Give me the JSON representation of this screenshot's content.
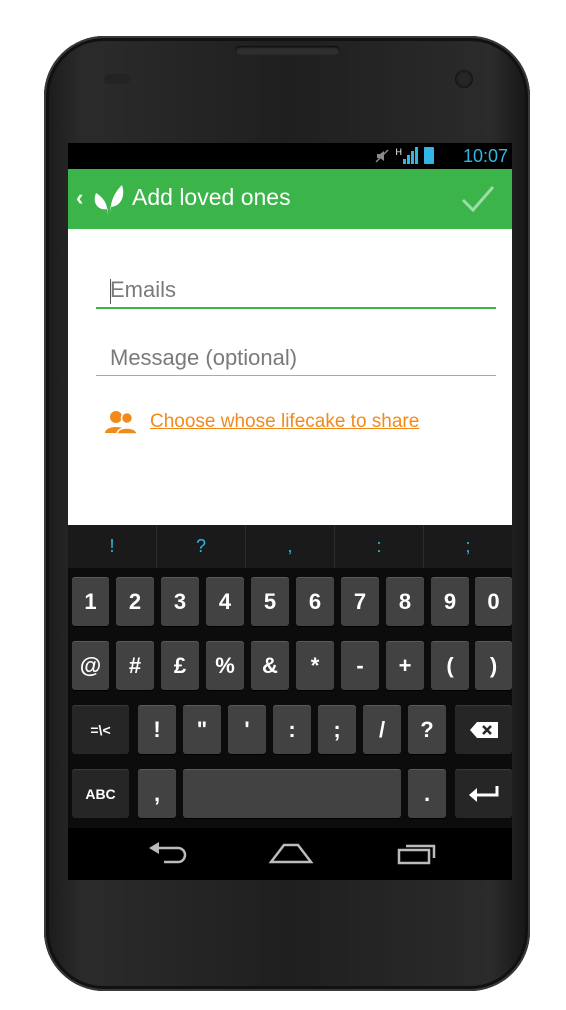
{
  "status_bar": {
    "time": "10:07",
    "network": "H",
    "icons": [
      "mute-icon",
      "signal-icon",
      "battery-icon"
    ],
    "accent_color": "#33b5e5"
  },
  "action_bar": {
    "title": "Add loved ones",
    "back_icon": "chevron-left-icon",
    "logo_icon": "leaf-logo-icon",
    "confirm_icon": "checkmark-icon",
    "bg_color": "#3bb44a"
  },
  "form": {
    "email_placeholder": "Emails",
    "message_placeholder": "Message (optional)",
    "share_link": "Choose whose lifecake to share",
    "share_icon": "people-icon",
    "link_color": "#f28a1a"
  },
  "keyboard": {
    "suggestions": [
      "!",
      "?",
      ",",
      ":",
      ";"
    ],
    "row1": [
      "1",
      "2",
      "3",
      "4",
      "5",
      "6",
      "7",
      "8",
      "9",
      "0"
    ],
    "row2": [
      "@",
      "#",
      "£",
      "%",
      "&",
      "*",
      "-",
      "+",
      "(",
      ")"
    ],
    "row3": [
      "=\\<",
      "!",
      "\"",
      "'",
      ":",
      ";",
      "/",
      "?"
    ],
    "row4": {
      "abc": "ABC",
      "comma": ",",
      "period": "."
    },
    "backspace_icon": "backspace-icon",
    "enter_icon": "enter-icon"
  },
  "nav_bar": {
    "icons": [
      "back-icon",
      "home-icon",
      "recent-apps-icon"
    ]
  }
}
